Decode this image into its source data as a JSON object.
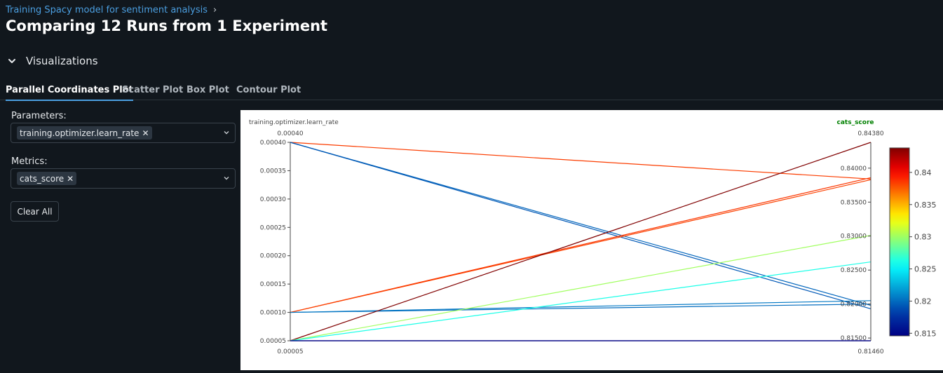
{
  "breadcrumb": {
    "label": "Training Spacy model for sentiment analysis",
    "separator": "›"
  },
  "page_title": "Comparing 12 Runs from 1 Experiment",
  "section": {
    "label": "Visualizations"
  },
  "tabs": [
    {
      "label": "Parallel Coordinates Plot",
      "active": true
    },
    {
      "label": "Scatter Plot",
      "active": false
    },
    {
      "label": "Box Plot",
      "active": false
    },
    {
      "label": "Contour Plot",
      "active": false
    }
  ],
  "controls": {
    "parameters_label": "Parameters:",
    "parameters_selected": "training.optimizer.learn_rate",
    "metrics_label": "Metrics:",
    "metrics_selected": "cats_score",
    "clear_label": "Clear All",
    "chip_remove": "✕"
  },
  "colors": {
    "accent": "#4b9fe1",
    "background": "#11171d",
    "metric_title": "#008000"
  },
  "chart_data": {
    "type": "parallel_coordinates",
    "axes": [
      {
        "label": "training.optimizer.learn_rate",
        "range": [
          5e-05,
          0.0004
        ],
        "top_label": "0.00040",
        "bottom_label": "0.00005",
        "ticks": [
          "0.00040",
          "0.00035",
          "0.00030",
          "0.00025",
          "0.00020",
          "0.00015",
          "0.00010",
          "0.00005"
        ],
        "tick_values": [
          0.0004,
          0.00035,
          0.0003,
          0.00025,
          0.0002,
          0.00015,
          0.0001,
          5e-05
        ]
      },
      {
        "label": "cats_score",
        "range": [
          0.8146,
          0.8438
        ],
        "top_label": "0.84380",
        "bottom_label": "0.81460",
        "ticks": [
          "0.84000",
          "0.83500",
          "0.83000",
          "0.82500",
          "0.82000",
          "0.81500"
        ],
        "tick_values": [
          0.84,
          0.835,
          0.83,
          0.825,
          0.82,
          0.815
        ]
      }
    ],
    "runs": [
      {
        "learn_rate": 0.0004,
        "cats_score": 0.8384
      },
      {
        "learn_rate": 0.0004,
        "cats_score": 0.8198
      },
      {
        "learn_rate": 0.0004,
        "cats_score": 0.8193
      },
      {
        "learn_rate": 0.0001,
        "cats_score": 0.8386
      },
      {
        "learn_rate": 0.0001,
        "cats_score": 0.8383
      },
      {
        "learn_rate": 0.0001,
        "cats_score": 0.82
      },
      {
        "learn_rate": 0.0001,
        "cats_score": 0.8205
      },
      {
        "learn_rate": 5e-05,
        "cats_score": 0.8438
      },
      {
        "learn_rate": 5e-05,
        "cats_score": 0.8301
      },
      {
        "learn_rate": 5e-05,
        "cats_score": 0.8262
      },
      {
        "learn_rate": 5e-05,
        "cats_score": 0.8146
      },
      {
        "learn_rate": 5e-05,
        "cats_score": 0.8146
      }
    ],
    "colorbar": {
      "ticks": [
        "0.84",
        "0.835",
        "0.83",
        "0.825",
        "0.82",
        "0.815"
      ],
      "tick_values": [
        0.84,
        0.835,
        0.83,
        0.825,
        0.82,
        0.815
      ],
      "range": [
        0.8146,
        0.8438
      ],
      "colorscale": "jet"
    }
  }
}
